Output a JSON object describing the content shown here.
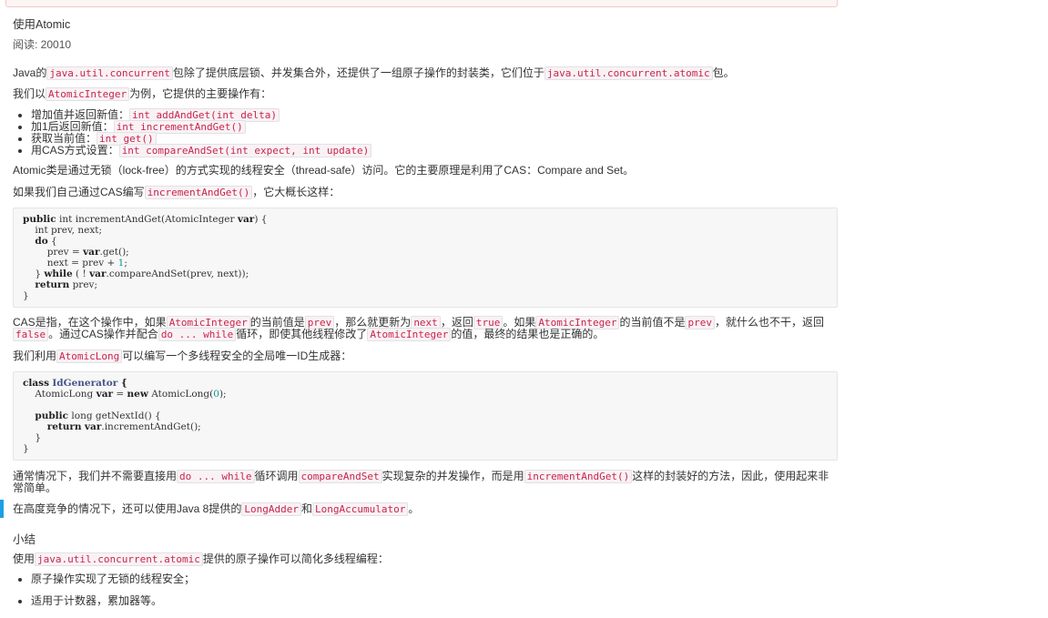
{
  "article": {
    "title": "使用Atomic",
    "reads": "阅读: 20010",
    "p1": {
      "t1": "Java的",
      "c1": "java.util.concurrent",
      "t2": "包除了提供底层锁、并发集合外，还提供了一组原子操作的封装类，它们位于",
      "c2": "java.util.concurrent.atomic",
      "t3": "包。"
    },
    "p2": {
      "t1": "我们以",
      "c1": "AtomicInteger",
      "t2": "为例，它提供的主要操作有："
    },
    "ops": [
      {
        "label": "增加值并返回新值：",
        "code": "int addAndGet(int delta)"
      },
      {
        "label": "加1后返回新值：",
        "code": "int incrementAndGet()"
      },
      {
        "label": "获取当前值：",
        "code": "int get()"
      },
      {
        "label": "用CAS方式设置：",
        "code": "int compareAndSet(int expect, int update)"
      }
    ],
    "p3": "Atomic类是通过无锁（lock-free）的方式实现的线程安全（thread-safe）访问。它的主要原理是利用了CAS：Compare and Set。",
    "p4": {
      "t1": "如果我们自己通过CAS编写",
      "c1": "incrementAndGet()",
      "t2": "，它大概长这样："
    },
    "code1": {
      "l1a": "public",
      "l1b": " int incrementAndGet(AtomicInteger ",
      "l1c": "var",
      "l1d": ") {",
      "l2": "    int prev, next;",
      "l3": "do",
      "l3b": " {",
      "l4a": "        prev = ",
      "l4b": "var",
      "l4c": ".get();",
      "l5a": "        next = prev + ",
      "l5b": "1",
      "l5c": ";",
      "l6a": "    } ",
      "l6b": "while",
      "l6c": " ( ! ",
      "l6d": "var",
      "l6e": ".compareAndSet(prev, next));",
      "l7a": "return",
      "l7b": " prev;",
      "l8": "}"
    },
    "p5": {
      "t1": "CAS是指，在这个操作中，如果",
      "c1": "AtomicInteger",
      "t2": "的当前值是",
      "c2": "prev",
      "t3": "，那么就更新为",
      "c3": "next",
      "t4": "，返回",
      "c4": "true",
      "t5": "。如果",
      "c5": "AtomicInteger",
      "t6": "的当前值不是",
      "c6": "prev",
      "t7": "，就什么也不干，返回",
      "c7": "false",
      "t8": "。通过CAS操作并配合",
      "c8": "do ... while",
      "t9": "循环，即使其他线程修改了",
      "c9": "AtomicInteger",
      "t10": "的值，最终的结果也是正确的。"
    },
    "p6": {
      "t1": "我们利用",
      "c1": "AtomicLong",
      "t2": "可以编写一个多线程安全的全局唯一ID生成器："
    },
    "code2": {
      "l1a": "class",
      "l1b": "IdGenerator",
      "l1c": " {",
      "l2a": "    AtomicLong ",
      "l2b": "var",
      "l2c": " = ",
      "l2d": "new",
      "l2e": " AtomicLong(",
      "l2f": "0",
      "l2g": ");",
      "l4a": "public",
      "l4b": " long getNextId() {",
      "l5a": "return",
      "l5b": "var",
      "l5c": ".incrementAndGet();",
      "l6": "    }",
      "l7": "}"
    },
    "p7": {
      "t1": "通常情况下，我们并不需要直接用",
      "c1": "do ... while",
      "t2": "循环调用",
      "c2": "compareAndSet",
      "t3": "实现复杂的并发操作，而是用",
      "c3": "incrementAndGet()",
      "t4": "这样的封装好的方法，因此，使用起来非常简单。"
    },
    "p8": {
      "t1": "在高度竞争的情况下，还可以使用Java 8提供的",
      "c1": "LongAdder",
      "t2": "和",
      "c2": "LongAccumulator",
      "t3": "。"
    },
    "summary_title": "小结",
    "p9": {
      "t1": "使用",
      "c1": "java.util.concurrent.atomic",
      "t2": "提供的原子操作可以简化多线程编程："
    },
    "summary": [
      "原子操作实现了无锁的线程安全；",
      "适用于计数器，累加器等。"
    ]
  }
}
